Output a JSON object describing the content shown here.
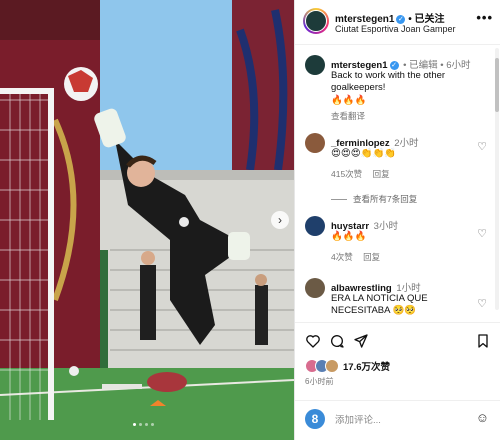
{
  "header": {
    "username": "mterstegen1",
    "verified": "✓",
    "follow_label": "• 已关注",
    "location": "Ciutat Esportiva Joan Gamper",
    "more_label": "•••"
  },
  "caption": {
    "username": "mterstegen1",
    "time": "• 已编辑 • 6小时",
    "text": "Back to work with the other goalkeepers!",
    "emojis": "🔥🔥🔥",
    "translate_label": "查看翻译"
  },
  "comments": [
    {
      "username": "_ferminlopez",
      "time": "2小时",
      "text": "😍😍😍👏👏👏",
      "likes": "415次赞",
      "reply": "回复",
      "view_replies": "查看所有7条回复",
      "avatar_color": "#8a5a3c"
    },
    {
      "username": "huystarr",
      "time": "3小时",
      "text": "🔥🔥🔥",
      "likes": "4次赞",
      "reply": "回复",
      "avatar_color": "#1f3f6b"
    },
    {
      "username": "albawrestling",
      "time": "1小时",
      "text": "ERA LA NOTICIA QUE NECESITABA 🥺🥺",
      "avatar_color": "#6b5a45"
    }
  ],
  "actions": {
    "like_icon": "heart-icon",
    "comment_icon": "comment-icon",
    "share_icon": "share-icon",
    "save_icon": "bookmark-icon"
  },
  "likes": {
    "count_label": "17.6万次赞",
    "posted": "6小时前",
    "avatar_colors": [
      "#d86c8f",
      "#5a7fb3",
      "#c89a63"
    ]
  },
  "add_comment": {
    "placeholder": "添加评论..."
  },
  "carousel": {
    "next_label": "›",
    "slide_count": 4,
    "active_slide": 1
  },
  "colors": {
    "accent": "#3897f0",
    "grass": "#4f9a4c",
    "stadium_wall": "#7a1d2b"
  }
}
